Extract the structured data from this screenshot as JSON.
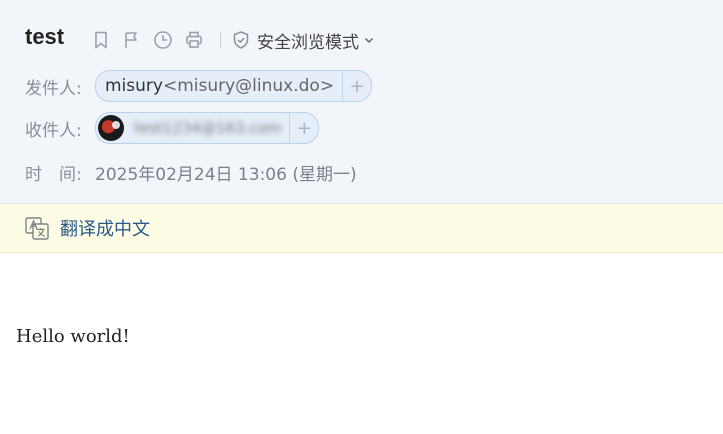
{
  "subject": "test",
  "toolbar": {
    "icons": [
      "bookmark-icon",
      "flag-icon",
      "clock-icon",
      "print-icon"
    ],
    "safe_mode_label": "安全浏览模式"
  },
  "from": {
    "label": "发件人:",
    "name": "misury",
    "address": "<misury@linux.do>",
    "add": "+"
  },
  "to": {
    "label": "收件人:",
    "address_blurred": "test1234@163.com",
    "add": "+"
  },
  "time": {
    "label": "时　间:",
    "value": "2025年02月24日 13:06 (星期一)"
  },
  "translate": {
    "label": "翻译成中文"
  },
  "body": {
    "text": "Hello world!"
  },
  "colors": {
    "header_bg": "#f2f5fa",
    "chip_bg": "#e5eef9",
    "translate_bg": "#fdfde5",
    "link": "#2a5a8a"
  }
}
